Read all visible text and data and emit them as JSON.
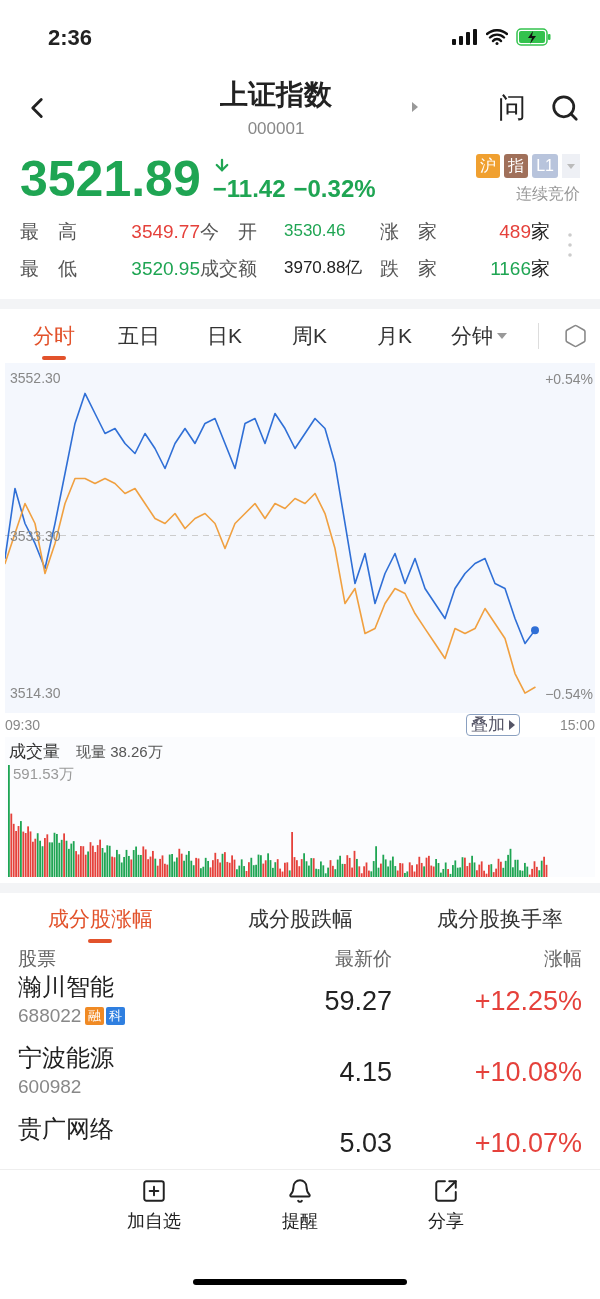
{
  "status_bar": {
    "time": "2:36"
  },
  "header": {
    "title": "上证指数",
    "code": "000001",
    "ask": "问"
  },
  "quote": {
    "price": "3521.89",
    "color": "#1fa553",
    "change": "−11.42",
    "percent": "−0.32%",
    "status": "连续竞价",
    "tags": [
      {
        "label": "沪",
        "color": "#f0a030"
      },
      {
        "label": "指",
        "color": "#a0705a"
      },
      {
        "label": "L1",
        "color": "#b8c4dc"
      }
    ],
    "stats": [
      {
        "label": "最　高",
        "value": "3549.77",
        "color": "#e5413b"
      },
      {
        "label": "今　开",
        "value": "3530.46",
        "color": "#1fa553"
      },
      {
        "label": "涨　家",
        "value": "489",
        "unit": "家",
        "color": "#e5413b"
      },
      {
        "label": "最　低",
        "value": "3520.95",
        "color": "#1fa553"
      },
      {
        "label": "成交额",
        "value": "3970.88亿",
        "color": "#222222"
      },
      {
        "label": "跌　家",
        "value": "1166",
        "unit": "家",
        "color": "#1fa553"
      }
    ]
  },
  "period_tabs": [
    {
      "label": "分时",
      "selected": true,
      "kind": "tab"
    },
    {
      "label": "五日",
      "selected": false,
      "kind": "tab"
    },
    {
      "label": "日K",
      "selected": false,
      "kind": "tab"
    },
    {
      "label": "周K",
      "selected": false,
      "kind": "tab"
    },
    {
      "label": "月K",
      "selected": false,
      "kind": "tab"
    },
    {
      "label": "分钟",
      "selected": false,
      "kind": "dropdown"
    }
  ],
  "chart": {
    "right_top": "+0.54%",
    "right_bottom": "−0.54%",
    "overlay_button": "叠加",
    "time_start": "09:30",
    "time_end": "15:00",
    "chart_data": {
      "type": "line",
      "ylim": [
        3511.9,
        3554.1
      ],
      "yticks": [
        {
          "value": 3552.3,
          "label": "3552.30"
        },
        {
          "value": 3533.3,
          "label": "3533.30"
        },
        {
          "value": 3514.3,
          "label": "3514.30"
        }
      ],
      "categories": [
        null,
        null,
        null,
        null,
        null,
        null,
        null,
        null,
        null,
        null,
        null,
        null,
        null,
        null,
        null,
        null,
        null,
        null,
        null,
        null,
        null,
        null,
        null,
        null,
        null,
        null,
        null,
        null,
        null,
        null,
        null,
        null,
        null,
        null,
        null,
        null,
        null,
        null,
        null,
        null,
        null,
        null,
        null,
        null,
        null,
        null,
        null,
        null,
        null,
        null,
        null,
        null,
        null,
        null,
        null,
        null,
        null,
        null,
        null,
        null
      ],
      "series": [
        {
          "color": "#2f6fd6",
          "values": [
            3530.53,
            3538.97,
            3534.75,
            3532.34,
            3529.32,
            3534.75,
            3540.78,
            3546.81,
            3550.43,
            3548.01,
            3545.6,
            3546.2,
            3544.4,
            3543.19,
            3545.6,
            3543.79,
            3541.38,
            3544.4,
            3546.2,
            3544.4,
            3546.81,
            3547.41,
            3544.4,
            3541.38,
            3546.81,
            3547.41,
            3544.4,
            3548.01,
            3546.2,
            3543.79,
            3545.6,
            3547.41,
            3546.2,
            3541.98,
            3534.75,
            3527.51,
            3531.13,
            3525.1,
            3528.72,
            3531.13,
            3527.51,
            3530.53,
            3526.91,
            3525.1,
            3523.29,
            3526.91,
            3528.72,
            3529.92,
            3530.53,
            3527.51,
            3526.91,
            3523.29,
            3520.28,
            3521.89,
            null,
            null,
            null,
            null,
            null,
            null
          ]
        },
        {
          "color": "#f0a040",
          "values": [
            3529.92,
            3533.54,
            3537.16,
            3534.75,
            3528.72,
            3532.34,
            3537.16,
            3540.17,
            3540.17,
            3539.57,
            3540.17,
            3539.57,
            3538.37,
            3538.97,
            3537.16,
            3535.35,
            3534.75,
            3535.95,
            3534.14,
            3535.35,
            3535.95,
            3534.75,
            3531.73,
            3534.75,
            3535.95,
            3537.16,
            3535.35,
            3537.16,
            3536.56,
            3537.76,
            3537.16,
            3538.37,
            3535.95,
            3531.73,
            3525.1,
            3526.91,
            3521.48,
            3522.08,
            3525.1,
            3526.91,
            3526.31,
            3523.89,
            3522.08,
            3520.28,
            3518.47,
            3522.08,
            3521.48,
            3522.08,
            3524.5,
            3522.69,
            3520.88,
            3516.66,
            3514.3,
            3515.0,
            null,
            null,
            null,
            null,
            null,
            null
          ]
        }
      ]
    }
  },
  "volume": {
    "title": "成交量",
    "current": "现量 38.26万",
    "max": "591.53万"
  },
  "list_tabs": [
    {
      "label": "成分股涨幅",
      "selected": true
    },
    {
      "label": "成分股跌幅",
      "selected": false
    },
    {
      "label": "成分股换手率",
      "selected": false
    }
  ],
  "table": {
    "columns": [
      "股票",
      "最新价",
      "涨幅"
    ],
    "rows": [
      {
        "name": "瀚川智能",
        "code": "688022",
        "tags": [
          {
            "label": "融",
            "color": "#f08a24"
          },
          {
            "label": "科",
            "color": "#2f7fe0"
          }
        ],
        "price": "59.27",
        "change": "+12.25%"
      },
      {
        "name": "宁波能源",
        "code": "600982",
        "tags": [],
        "price": "4.15",
        "change": "+10.08%"
      },
      {
        "name": "贵广网络",
        "price": "5.03",
        "change": "+10.07%"
      }
    ]
  },
  "bottom_bar": [
    {
      "label": "加自选"
    },
    {
      "label": "提醒"
    },
    {
      "label": "分享"
    }
  ]
}
